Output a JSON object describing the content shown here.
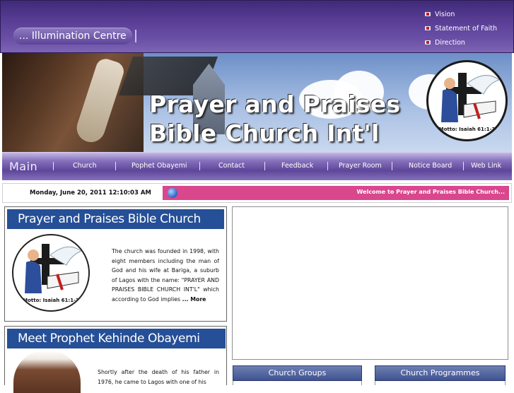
{
  "header": {
    "brand": "... Illumination Centre",
    "links": [
      {
        "label": "Vision",
        "icon": "bullet-icon"
      },
      {
        "label": "Statement of Faith",
        "icon": "bullet-icon"
      },
      {
        "label": "Direction",
        "icon": "bullet-icon"
      }
    ]
  },
  "banner": {
    "title_line1": "Prayer and Praises",
    "title_line2": "Bible Church  Int'l",
    "logo_motto": "Motto: Isaiah 61:1-3"
  },
  "menu": {
    "main_label": "Main",
    "items": [
      "Church",
      "Pophet Obayemi",
      "Contact",
      "Feedback",
      "Prayer Room",
      "Notice Board",
      "Web Link"
    ]
  },
  "status": {
    "datetime": "Monday, June 20, 2011 12:10:03 AM",
    "ticker": "Welcome to Prayer and Praises Bible Church..."
  },
  "panels": {
    "church": {
      "title": "Prayer and Praises Bible Church",
      "text": "The church was founded in 1998, with eight members including the man of God and his wife at Bariga, a suburb of Lagos with the name: \"PRAYER AND PRAISES BIBLE CHURCH INT'L\" which according to God implies",
      "more": "... More",
      "logo_motto": "Motto: Isaiah 61:1-3"
    },
    "prophet": {
      "title": "Meet Prophet Kehinde Obayemi",
      "text": "Shortly after the death of his father in 1976, he came to Lagos with one of his"
    }
  },
  "right": {
    "groups_label": "Church Groups",
    "programmes_label": "Church Programmes"
  },
  "colors": {
    "header_purple": "#5a3e96",
    "panel_blue": "#254f96",
    "ticker_pink": "#d9478d"
  }
}
